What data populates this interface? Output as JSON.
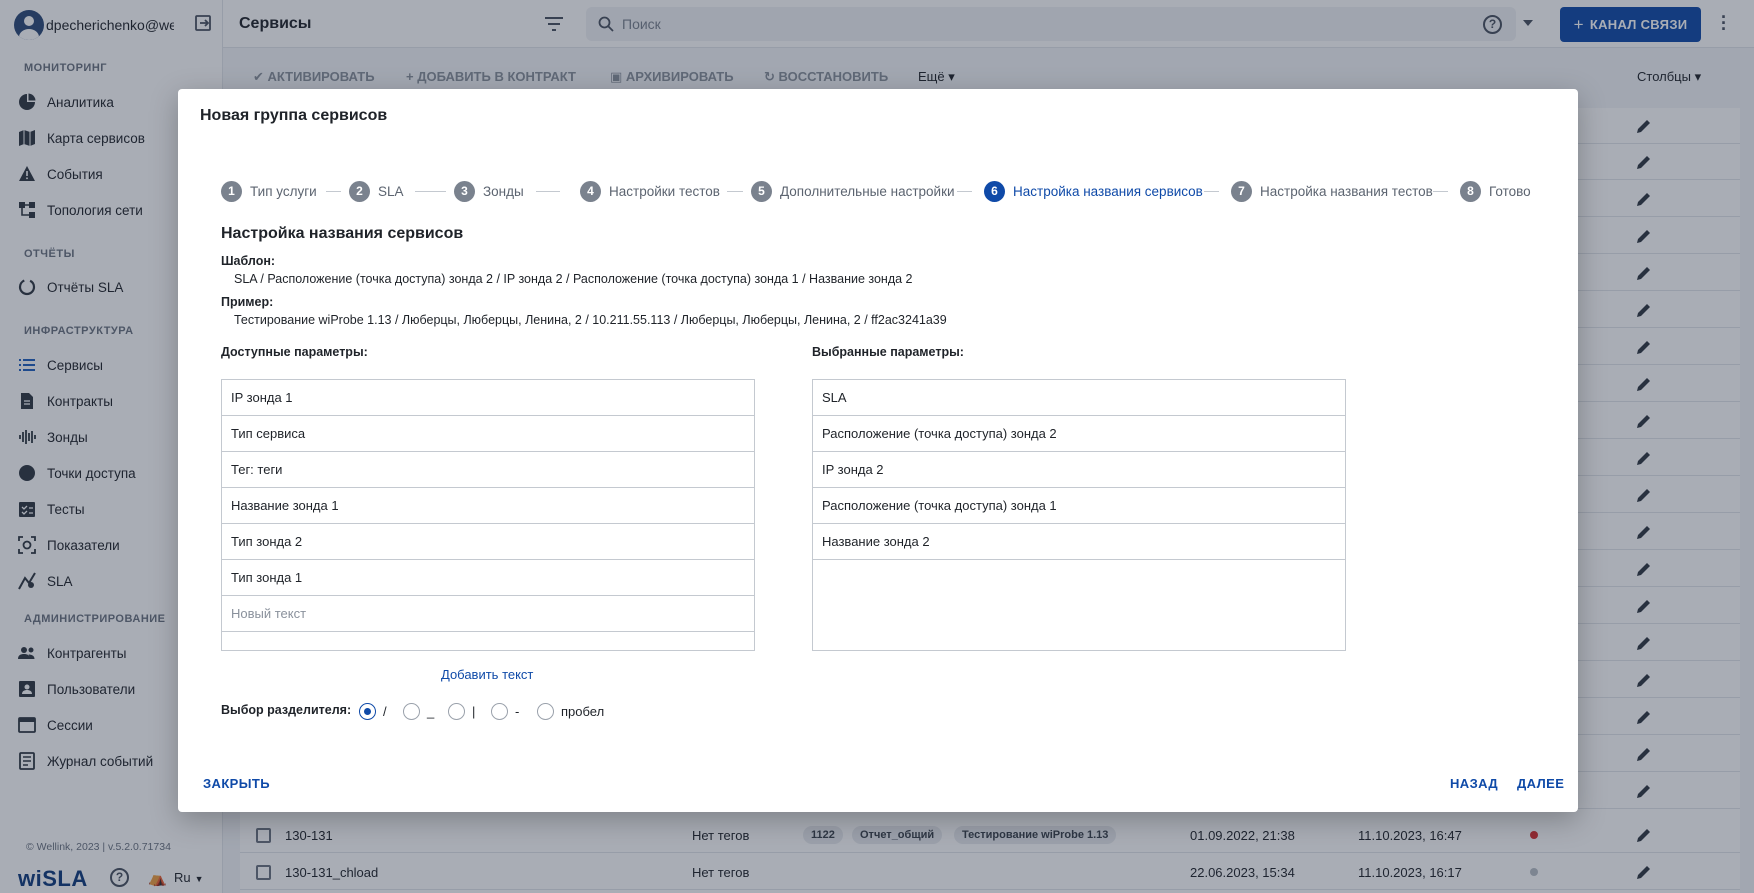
{
  "user": {
    "name": "dpecherichenko@wellink.ru"
  },
  "sidebar": {
    "sections": [
      {
        "title": "МОНИТОРИНГ",
        "items": [
          {
            "label": "Аналитика",
            "icon": "pie-chart-icon"
          },
          {
            "label": "Карта сервисов",
            "icon": "map-icon"
          },
          {
            "label": "События",
            "icon": "warning-icon"
          },
          {
            "label": "Топология сети",
            "icon": "topology-icon"
          }
        ]
      },
      {
        "title": "ОТЧЁТЫ",
        "items": [
          {
            "label": "Отчёты SLA",
            "icon": "sla-report-icon"
          }
        ]
      },
      {
        "title": "ИНФРАСТРУКТУРА",
        "items": [
          {
            "label": "Сервисы",
            "icon": "services-list-icon"
          },
          {
            "label": "Контракты",
            "icon": "contract-icon"
          },
          {
            "label": "Зонды",
            "icon": "probe-icon"
          },
          {
            "label": "Точки доступа",
            "icon": "access-point-icon"
          },
          {
            "label": "Тесты",
            "icon": "tests-icon"
          },
          {
            "label": "Показатели",
            "icon": "metrics-icon"
          },
          {
            "label": "SLA",
            "icon": "sla-icon"
          }
        ]
      },
      {
        "title": "АДМИНИСТРИРОВАНИЕ",
        "items": [
          {
            "label": "Контрагенты",
            "icon": "people-icon"
          },
          {
            "label": "Пользователи",
            "icon": "user-card-icon"
          },
          {
            "label": "Сессии",
            "icon": "sessions-icon"
          },
          {
            "label": "Журнал событий",
            "icon": "journal-icon"
          }
        ]
      }
    ],
    "footer": "© Wellink, 2023 | v.5.2.0.71734",
    "brand": "wiSLA",
    "lang": "Ru"
  },
  "header": {
    "title": "Сервисы",
    "search_placeholder": "Поиск",
    "channel_button": "КАНАЛ СВЯЗИ"
  },
  "toolbar": {
    "activate": "АКТИВИРОВАТЬ",
    "add_to_contract": "ДОБАВИТЬ В КОНТРАКТ",
    "archive": "АРХИВИРОВАТЬ",
    "restore": "ВОССТАНОВИТЬ",
    "more": "Ещё",
    "columns": "Столбцы"
  },
  "table": {
    "rows": [
      {
        "name": "130-131",
        "tags_text": "Нет тегов",
        "badges": [
          "1122",
          "Отчет_общий",
          "Тестирование wiProbe 1.13"
        ],
        "created": "01.09.2022, 21:38",
        "updated": "11.10.2023, 16:47",
        "status_color": "#d93030"
      },
      {
        "name": "130-131_chload",
        "tags_text": "Нет тегов",
        "badges": [],
        "created": "22.06.2023, 15:34",
        "updated": "11.10.2023, 16:17",
        "status_color": "#b9bec6"
      }
    ]
  },
  "modal": {
    "title": "Новая группа сервисов",
    "steps": [
      {
        "num": "1",
        "label": "Тип услуги"
      },
      {
        "num": "2",
        "label": "SLA"
      },
      {
        "num": "3",
        "label": "Зонды"
      },
      {
        "num": "4",
        "label": "Настройки тестов"
      },
      {
        "num": "5",
        "label": "Дополнительные настройки"
      },
      {
        "num": "6",
        "label": "Настройка названия сервисов"
      },
      {
        "num": "7",
        "label": "Настройка названия тестов"
      },
      {
        "num": "8",
        "label": "Готово"
      }
    ],
    "active_step": 6,
    "section_title": "Настройка названия сервисов",
    "template_label": "Шаблон:",
    "template_value": "SLA / Расположение (точка доступа) зонда 2 / IP зонда 2 / Расположение (точка доступа) зонда 1 / Название зонда 2",
    "example_label": "Пример:",
    "example_value": "Тестирование wiProbe 1.13 / Люберцы, Люберцы, Ленина, 2 / 10.211.55.113 / Люберцы, Люберцы, Ленина, 2 / ff2ac3241a39",
    "available_label": "Доступные параметры:",
    "available": [
      "IP зонда 1",
      "Тип сервиса",
      "Тег: теги",
      "Название зонда 1",
      "Тип зонда 2",
      "Тип зонда 1"
    ],
    "new_text_placeholder": "Новый текст",
    "selected_label": "Выбранные параметры:",
    "selected": [
      "SLA",
      "Расположение (точка доступа) зонда 2",
      "IP зонда 2",
      "Расположение (точка доступа) зонда 1",
      "Название зонда 2"
    ],
    "add_text": "Добавить текст",
    "separator_label": "Выбор разделителя:",
    "separators": [
      "/",
      "_",
      "|",
      "-",
      "пробел"
    ],
    "selected_separator": "/",
    "close": "ЗАКРЫТЬ",
    "back": "НАЗАД",
    "next": "ДАЛЕЕ"
  },
  "colors": {
    "primary": "#0f4aa8",
    "active_step": "#0f4aa8",
    "status_red": "#d93030"
  }
}
